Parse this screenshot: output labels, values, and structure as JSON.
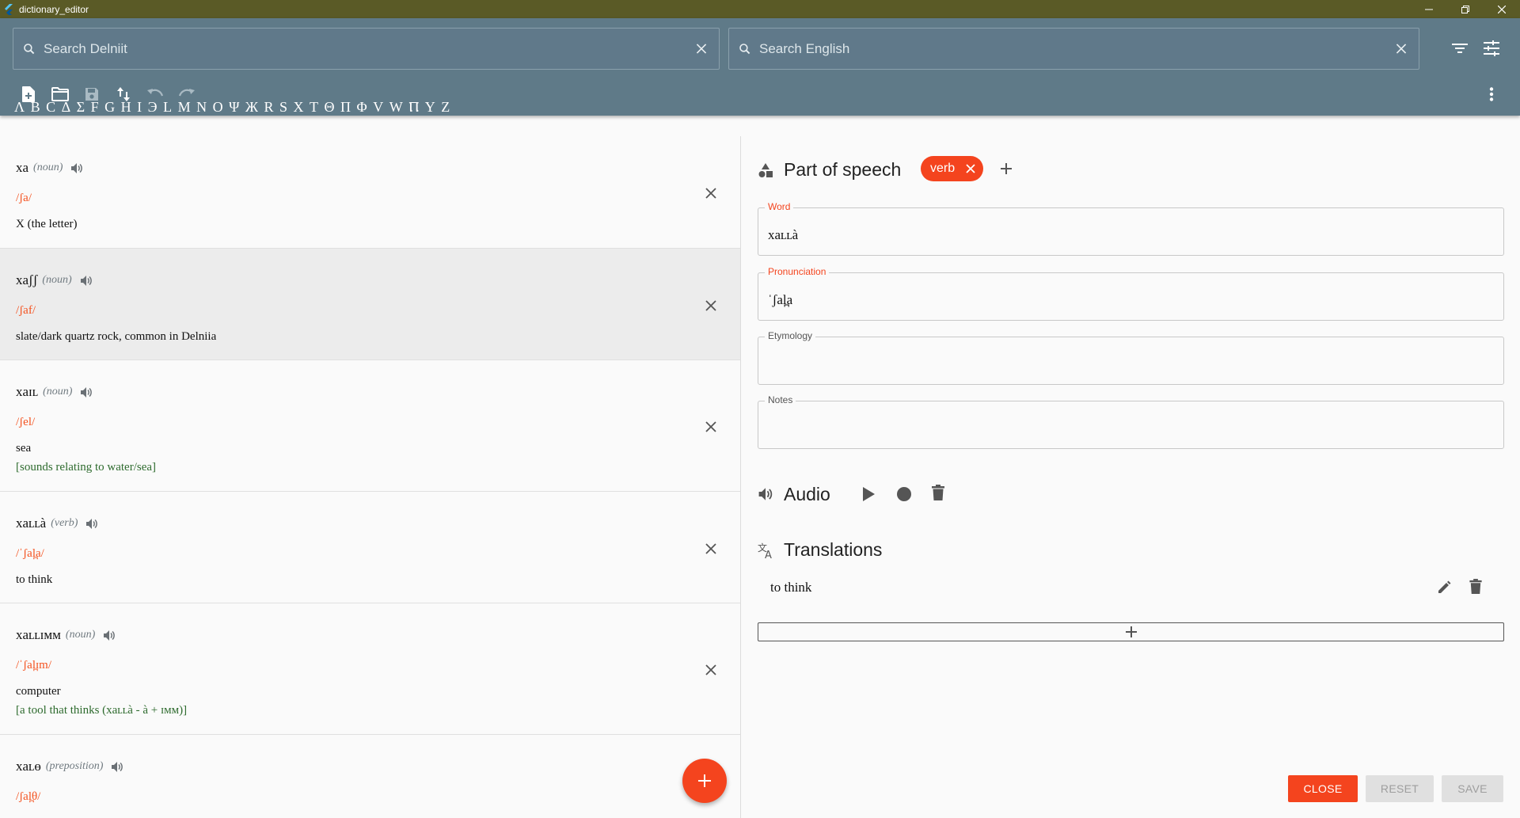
{
  "window": {
    "title": "dictionary_editor",
    "titlebar_color": "#5a5a26"
  },
  "appbar": {
    "color": "#5f7a88",
    "search_delniit_placeholder": "Search Delniit",
    "search_english_placeholder": "Search English",
    "letters": [
      "Λ",
      "B",
      "C",
      "Δ",
      "Σ",
      "F",
      "G",
      "H",
      "I",
      "Э",
      "L",
      "M",
      "N",
      "O",
      "Ψ",
      "Ж",
      "R",
      "S",
      "X",
      "T",
      "Θ",
      "Π",
      "Φ",
      "V",
      "W",
      "Ⲡ",
      "Y",
      "Z"
    ]
  },
  "entries": [
    {
      "word": "xa",
      "pos": "(noun)",
      "ipa": "/ʃa/",
      "definition": "X (the letter)",
      "etymology": ""
    },
    {
      "word": "xaʃʃ",
      "pos": "(noun)",
      "ipa": "/ʃaf/",
      "definition": "slate/dark quartz rock, common in Delniia",
      "etymology": ""
    },
    {
      "word": "xaɪʟ",
      "pos": "(noun)",
      "ipa": "/ʃel/",
      "definition": "sea",
      "etymology": "[sounds relating to water/sea]"
    },
    {
      "word": "xaʟʟà",
      "pos": "(verb)",
      "ipa": "/ˈʃal̪a/",
      "definition": "to think",
      "etymology": ""
    },
    {
      "word": "xaʟʟɪᴍᴍ",
      "pos": "(noun)",
      "ipa": "/ˈʃal̪ɪm/",
      "definition": "computer",
      "etymology": "[a tool that thinks (xaʟʟà - à + ɪᴍᴍ)]"
    },
    {
      "word": "xaʟɵ",
      "pos": "(preposition)",
      "ipa": "/ʃal̪θ/",
      "definition": "",
      "etymology": ""
    }
  ],
  "editor": {
    "part_of_speech_title": "Part of speech",
    "pos_chip": "verb",
    "fields": {
      "word_label": "Word",
      "word_value": "xaʟʟà",
      "pron_label": "Pronunciation",
      "pron_value": "ˈʃal̪a",
      "ety_label": "Etymology",
      "ety_value": "",
      "notes_label": "Notes",
      "notes_value": ""
    },
    "audio_title": "Audio",
    "translations_title": "Translations",
    "translations": [
      "to think"
    ],
    "buttons": {
      "close": "CLOSE",
      "reset": "RESET",
      "save": "SAVE"
    },
    "accent_color": "#f4441e"
  }
}
